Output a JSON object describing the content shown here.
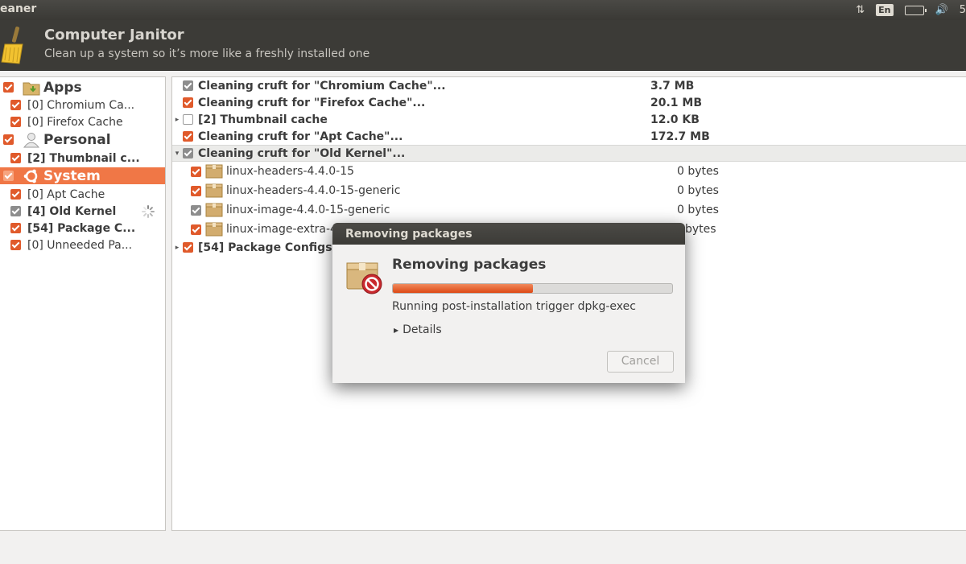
{
  "window": {
    "title_fragment": "eaner"
  },
  "tray": {
    "network_icon": "network-arrows-icon",
    "keyboard_layout": "En",
    "battery_icon": "battery-icon",
    "volume_icon": "volume-icon",
    "clock_fragment": "5"
  },
  "header": {
    "title": "Computer Janitor",
    "subtitle": "Clean up a system so it’s more like a freshly installed one"
  },
  "sidebar": {
    "items": [
      {
        "label": "Apps",
        "type": "category",
        "checked": true
      },
      {
        "label": "[0] Chromium Ca...",
        "type": "item",
        "checked": true
      },
      {
        "label": "[0] Firefox Cache",
        "type": "item",
        "checked": true
      },
      {
        "label": "Personal",
        "type": "category",
        "checked": true
      },
      {
        "label": "[2] Thumbnail c...",
        "type": "item",
        "checked": true,
        "bold": true
      },
      {
        "label": "System",
        "type": "category",
        "checked": true,
        "selected": true
      },
      {
        "label": "[0] Apt Cache",
        "type": "item",
        "checked": true
      },
      {
        "label": "[4] Old Kernel",
        "type": "item",
        "checked": true,
        "bold": true,
        "busy": true
      },
      {
        "label": "[54] Package C...",
        "type": "item",
        "checked": true,
        "bold": true
      },
      {
        "label": "[0] Unneeded Pa...",
        "type": "item",
        "checked": true
      }
    ]
  },
  "list": {
    "rows": [
      {
        "name": "Cleaning cruft for \"Chromium Cache\"...",
        "size": "3.7 MB",
        "check": "grey"
      },
      {
        "name": "Cleaning cruft for \"Firefox Cache\"...",
        "size": "20.1 MB",
        "check": "orange"
      },
      {
        "name": "[2] Thumbnail cache",
        "size": "12.0 KB",
        "check": "empty",
        "expander": "collapsed"
      },
      {
        "name": "Cleaning cruft for \"Apt Cache\"...",
        "size": "172.7 MB",
        "check": "orange"
      },
      {
        "name": "Cleaning cruft for \"Old Kernel\"...",
        "size": "",
        "check": "grey",
        "expander": "expanded"
      }
    ],
    "packages": [
      {
        "name": "linux-headers-4.4.0-15",
        "size": "0 bytes",
        "check": "orange"
      },
      {
        "name": "linux-headers-4.4.0-15-generic",
        "size": "0 bytes",
        "check": "orange"
      },
      {
        "name": "linux-image-4.4.0-15-generic",
        "size": "0 bytes",
        "check": "grey"
      },
      {
        "name": "linux-image-extra-4.",
        "size": "bytes",
        "check": "orange"
      }
    ],
    "last_row": {
      "name": "[54] Package Configs",
      "check": "orange",
      "expander": "collapsed"
    }
  },
  "dialog": {
    "title": "Removing packages",
    "heading": "Removing packages",
    "progress": 0.5,
    "status": "Running post-installation trigger dpkg-exec",
    "details_label": "Details",
    "cancel_label": "Cancel"
  },
  "colors": {
    "accent": "#e05a2b",
    "selected_row": "#f07746",
    "header_bg": "#3c3b37"
  }
}
